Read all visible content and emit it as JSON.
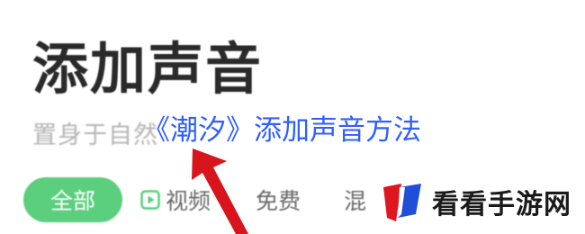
{
  "header": {
    "title": "添加声音",
    "subtitle": "置身于自然"
  },
  "overlay": {
    "caption": "《潮汐》添加声音方法",
    "caption_color": "#2f5fff",
    "arrow_color": "#d8141c"
  },
  "filters": {
    "all_label": "全部",
    "video_label": "视频",
    "free_label": "免费",
    "cut_label": "混",
    "active_color": "#5bcf7e",
    "video_icon": "play-square-icon"
  },
  "watermark": {
    "text": "看看手游网",
    "logo_icon": "red-blue-flag-logo"
  }
}
